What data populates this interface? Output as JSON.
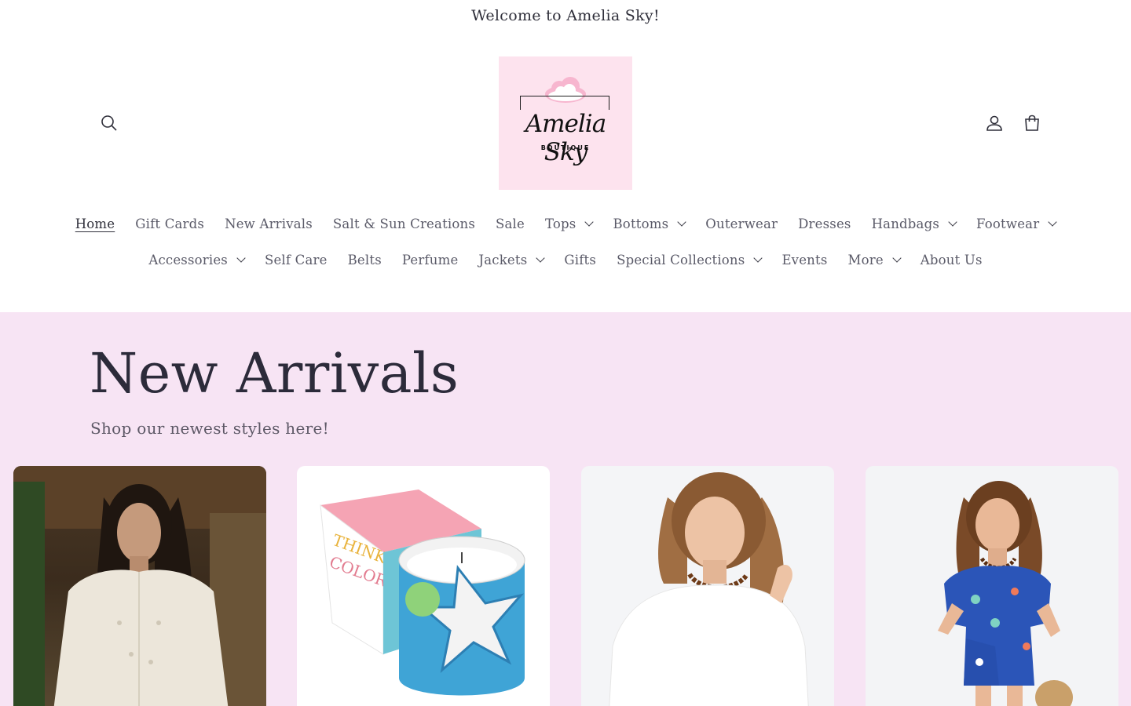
{
  "announcement": {
    "text": "Welcome to Amelia Sky!"
  },
  "header": {
    "logo": {
      "script_text": "Amelia Sky",
      "sub_text": "BOUTIQUE"
    },
    "icons": [
      "search-icon",
      "account-icon",
      "cart-icon"
    ]
  },
  "nav": {
    "row1": [
      {
        "label": "Home",
        "active": true,
        "dropdown": false
      },
      {
        "label": "Gift Cards",
        "dropdown": false
      },
      {
        "label": "New Arrivals",
        "dropdown": false
      },
      {
        "label": "Salt & Sun Creations",
        "dropdown": false
      },
      {
        "label": "Sale",
        "dropdown": false
      },
      {
        "label": "Tops",
        "dropdown": true
      },
      {
        "label": "Bottoms",
        "dropdown": true
      },
      {
        "label": "Outerwear",
        "dropdown": false
      },
      {
        "label": "Dresses",
        "dropdown": false
      },
      {
        "label": "Handbags",
        "dropdown": true
      },
      {
        "label": "Footwear",
        "dropdown": true
      }
    ],
    "row2": [
      {
        "label": "Accessories",
        "dropdown": true
      },
      {
        "label": "Self Care",
        "dropdown": false
      },
      {
        "label": "Belts",
        "dropdown": false
      },
      {
        "label": "Perfume",
        "dropdown": false
      },
      {
        "label": "Jackets",
        "dropdown": true
      },
      {
        "label": "Gifts",
        "dropdown": false
      },
      {
        "label": "Special Collections",
        "dropdown": true
      },
      {
        "label": "Events",
        "dropdown": false
      },
      {
        "label": "More",
        "dropdown": true
      },
      {
        "label": "About Us",
        "dropdown": false
      }
    ]
  },
  "banner": {
    "title": "New Arrivals",
    "subtitle": "Shop our newest styles here!",
    "background": "#f7e4f4"
  },
  "products": [
    {
      "image": "woman-white-eyelet-romper-photo"
    },
    {
      "image": "think-color-candle-photo",
      "box_text": "THINK COLOR"
    },
    {
      "image": "woman-white-top-photo"
    },
    {
      "image": "woman-blue-floral-romper-photo"
    }
  ],
  "colors": {
    "text": "#2c2b3a",
    "nav_text": "#5a5a68",
    "logo_bg": "#fde3ee",
    "banner_bg": "#f7e4f4"
  }
}
